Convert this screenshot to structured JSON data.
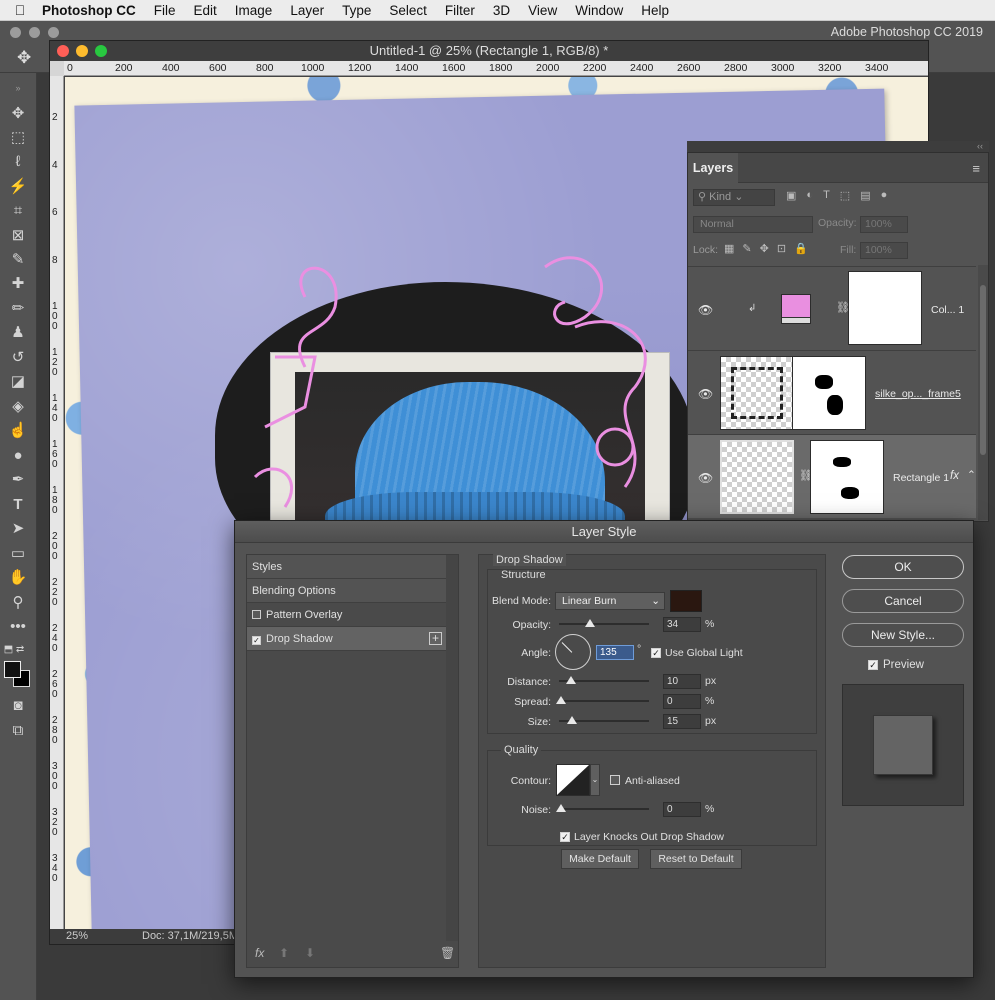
{
  "menubar": {
    "apple": "",
    "app_name": "Photoshop CC",
    "items": [
      "File",
      "Edit",
      "Image",
      "Layer",
      "Type",
      "Select",
      "Filter",
      "3D",
      "View",
      "Window",
      "Help"
    ]
  },
  "app_title": "Adobe Photoshop CC 2019",
  "document": {
    "title": "Untitled-1 @ 25% (Rectangle 1, RGB/8) *",
    "ruler_h": [
      "0",
      "200",
      "400",
      "600",
      "800",
      "1000",
      "1200",
      "1400",
      "1600",
      "1800",
      "2000",
      "2200",
      "2400",
      "2600",
      "2800",
      "3000",
      "3200",
      "3400"
    ],
    "ruler_v": [
      "2",
      "4",
      "6",
      "8",
      "1 0 0",
      "1 2 0",
      "1 4 0",
      "1 6 0",
      "1 8 0",
      "2 0 0",
      "2 2 0",
      "2 4 0",
      "2 6 0",
      "2 8 0",
      "3 0 0",
      "3 2 0",
      "3 4 0"
    ],
    "zoom": "25%",
    "doc_size": "Doc: 37,1M/219,5M"
  },
  "layers_panel": {
    "tab": "Layers",
    "kind_label": "Kind",
    "blend_mode": "Normal",
    "opacity_label": "Opacity:",
    "opacity_value": "100%",
    "lock_label": "Lock:",
    "fill_label": "Fill:",
    "fill_value": "100%",
    "layers": [
      {
        "name": "Col... 1",
        "color": "#e98fe0"
      },
      {
        "name": "silke_op..._frame5"
      },
      {
        "name": "Rectangle 1",
        "fx": "fx"
      }
    ]
  },
  "dialog": {
    "title": "Layer Style",
    "styles_list": [
      {
        "label": "Styles"
      },
      {
        "label": "Blending Options"
      },
      {
        "label": "Pattern Overlay",
        "checked": false
      },
      {
        "label": "Drop Shadow",
        "checked": true,
        "plus": "+"
      }
    ],
    "footer_icons": {
      "fx": "fx",
      "up": "⬆",
      "down": "⬇",
      "trash": "🗑"
    },
    "section_title": "Drop Shadow",
    "structure": {
      "title": "Structure",
      "blend_mode_label": "Blend Mode:",
      "blend_mode_value": "Linear Burn",
      "shadow_color": "#2a1710",
      "opacity_label": "Opacity:",
      "opacity_value": "34",
      "opacity_unit": "%",
      "opacity_fraction": 0.34,
      "angle_label": "Angle:",
      "angle_value": "135",
      "angle_unit": "°",
      "use_global_light": "Use Global Light",
      "distance_label": "Distance:",
      "distance_value": "10",
      "distance_unit": "px",
      "spread_label": "Spread:",
      "spread_value": "0",
      "spread_unit": "%",
      "size_label": "Size:",
      "size_value": "15",
      "size_unit": "px"
    },
    "quality": {
      "title": "Quality",
      "contour_label": "Contour:",
      "anti_aliased": "Anti-aliased",
      "noise_label": "Noise:",
      "noise_value": "0",
      "noise_unit": "%"
    },
    "knocks_out": "Layer Knocks Out Drop Shadow",
    "make_default": "Make Default",
    "reset_default": "Reset to Default",
    "buttons": {
      "ok": "OK",
      "cancel": "Cancel",
      "new_style": "New Style..."
    },
    "preview_label": "Preview"
  }
}
